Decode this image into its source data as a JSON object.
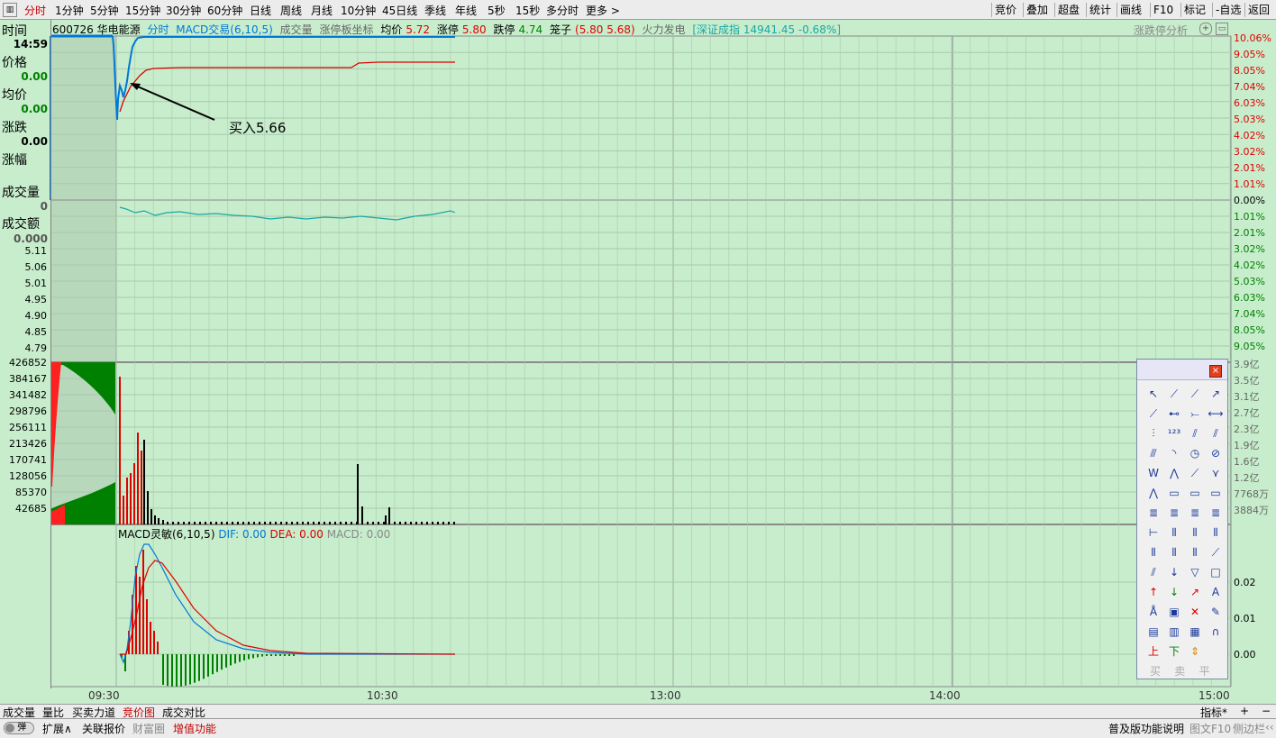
{
  "toolbar": {
    "left_tabs": [
      "分时",
      "1分钟",
      "5分钟",
      "15分钟",
      "30分钟",
      "60分钟",
      "日线",
      "周线",
      "月线",
      "10分钟",
      "45日线",
      "季线",
      "年线",
      "5秒",
      "15秒",
      "多分时",
      "更多 >"
    ],
    "active_tab": "分时",
    "right_buttons": [
      "竞价",
      "叠加",
      "超盘",
      "统计",
      "画线",
      "F10",
      "标记",
      "-自选",
      "返回"
    ]
  },
  "left_panel": {
    "time_label": "时间",
    "time_value": "14:59",
    "price_label": "价格",
    "price_value": "0.00",
    "avg_label": "均价",
    "avg_value": "0.00",
    "change_label": "涨跌",
    "change_value": "0.00",
    "pct_label": "涨幅",
    "volume_label": "成交量",
    "volume_value": "0",
    "amount_label": "成交额",
    "amount_value": "0.000",
    "price_ticks": [
      "5.11",
      "5.06",
      "5.01",
      "4.95",
      "4.90",
      "4.85",
      "4.79"
    ],
    "volume_ticks": [
      "426852",
      "384167",
      "341482",
      "298796",
      "256111",
      "213426",
      "170741",
      "128056",
      "85370",
      "42685"
    ]
  },
  "header": {
    "stock": "600726 华电能源",
    "mode": "分时",
    "macd_trade": "MACD交易(6,10,5)",
    "vol": "成交量",
    "limit_coord": "涨停板坐标",
    "avg_label": "均价",
    "avg_value": "5.72",
    "up_limit_label": "涨停",
    "up_limit_value": "5.80",
    "down_limit_label": "跌停",
    "down_limit_value": "4.74",
    "cage_label": "笼子",
    "cage_value": "(5.80 5.68)",
    "sector": "火力发电",
    "index": "[深证成指 14941.45 -0.68%]",
    "right_link": "涨跌停分析"
  },
  "right_axis": {
    "pct_up": [
      "10.06%",
      "9.05%",
      "8.05%",
      "7.04%",
      "6.03%",
      "5.03%",
      "4.02%",
      "3.02%",
      "2.01%",
      "1.01%",
      "0.00%"
    ],
    "pct_down": [
      "1.01%",
      "2.01%",
      "3.02%",
      "4.02%",
      "5.03%",
      "6.03%",
      "7.04%",
      "8.05%",
      "9.05%"
    ],
    "amount_ticks": [
      "3.9亿",
      "3.5亿",
      "3.1亿",
      "2.7亿",
      "2.3亿",
      "1.9亿",
      "1.6亿",
      "1.2亿",
      "7768万",
      "3884万"
    ],
    "macd_ticks": [
      "0.02",
      "0.01",
      "0.00"
    ]
  },
  "annotation": {
    "text": "买入5.66"
  },
  "macd": {
    "title": "MACD灵敏(6,10,5)",
    "dif": "DIF: 0.00",
    "dea": "DEA: 0.00",
    "macd": "MACD: 0.00"
  },
  "time_axis": [
    "09:30",
    "10:30",
    "13:00",
    "14:00",
    "15:00"
  ],
  "bottom_tabs": [
    "成交量",
    "量比",
    "买卖力道",
    "竞价图",
    "成交对比"
  ],
  "bottom_active": "竞价图",
  "bottom_right": [
    "指标*",
    "+",
    "−"
  ],
  "status": {
    "toggle": "弹",
    "items": [
      "扩展∧",
      "关联报价",
      "财富圈",
      "增值功能"
    ],
    "right": [
      "普及版功能说明",
      "图文F10",
      "侧边栏",
      "‹‹"
    ]
  },
  "toolbox_labels": [
    "买",
    "卖",
    "平"
  ],
  "colors": {
    "red": "#e00000",
    "green": "#008000",
    "blue": "#0078d7",
    "cyan": "#1aa6a6",
    "bg": "#c7edcc"
  }
}
